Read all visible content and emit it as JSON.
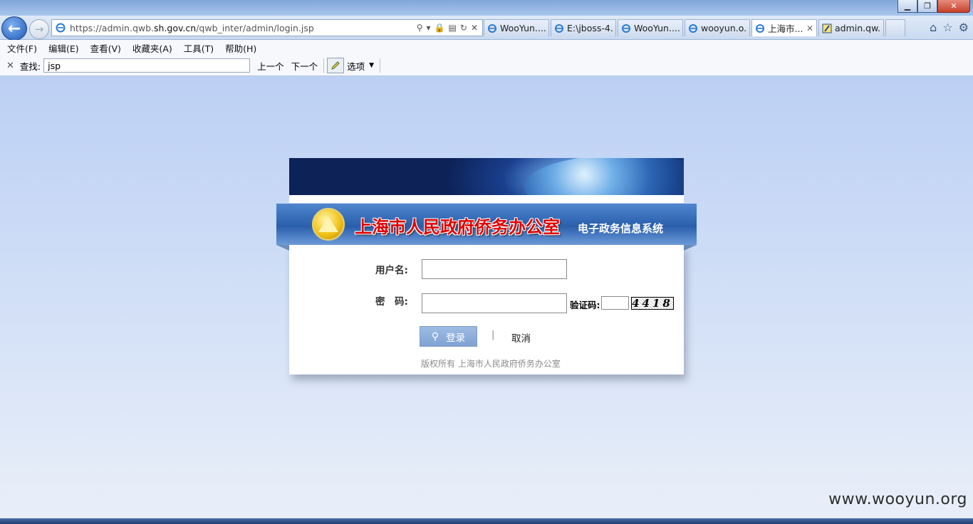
{
  "browser": {
    "url": {
      "prefix": "https://admin.qwb.",
      "domain": "sh.gov.cn",
      "path": "/qwb_inter/admin/login.jsp"
    },
    "tabs": [
      {
        "label": "WooYun....",
        "active": false
      },
      {
        "label": "E:\\jboss-4...",
        "active": false
      },
      {
        "label": "WooYun....",
        "active": false
      },
      {
        "label": "wooyun.o...",
        "active": false
      },
      {
        "label": "上海市...",
        "active": true
      },
      {
        "label": "admin.qw...",
        "active": false
      }
    ],
    "menu": [
      "文件(F)",
      "编辑(E)",
      "查看(V)",
      "收藏夹(A)",
      "工具(T)",
      "帮助(H)"
    ],
    "find": {
      "label": "查找:",
      "value": "jsp",
      "prev": "上一个",
      "next": "下一个",
      "options": "选项"
    },
    "window_controls": {
      "minimize": "▁",
      "restore": "❐",
      "close": "✕"
    }
  },
  "header": {
    "org_name": "上海市人民政府侨务办公室",
    "system_name": "电子政务信息系统"
  },
  "form": {
    "username_label": "用户名:",
    "password_label": "密　码:",
    "captcha_label": "验证码:",
    "captcha_value": "4418",
    "login_button": "登录",
    "separator": "|",
    "cancel_button": "取消",
    "copyright": "版权所有  上海市人民政府侨务办公室"
  },
  "watermark": "www.wooyun.org",
  "colors": {
    "page_bg": "#c4d5f2",
    "org_name": "#e00000",
    "login_button": "#8fb0dc"
  }
}
